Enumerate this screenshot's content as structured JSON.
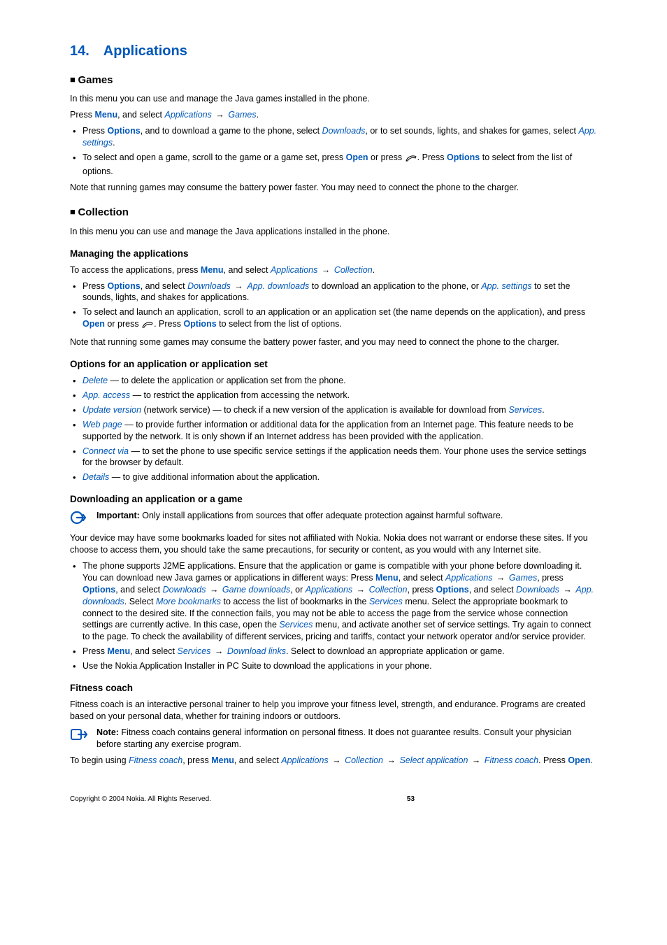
{
  "title": "14. Applications",
  "sections": {
    "games": {
      "heading": "Games",
      "p1": "In this menu you can use and manage the Java games installed in the phone.",
      "p2_pre": "Press ",
      "p2_menu": "Menu",
      "p2_mid": ", and select ",
      "p2_applications": "Applications",
      "p2_games": "Games",
      "p2_end": ".",
      "bullets": [
        {
          "pre": "Press ",
          "options": "Options",
          "mid1": ", and to download a game to the phone, select ",
          "downloads": "Downloads",
          "mid2": ", or to set sounds, lights, and shakes for games, select ",
          "appsettings": "App. settings",
          "end": "."
        },
        {
          "pre": "To select and open a game, scroll to the game or a game set, press ",
          "open": "Open",
          "mid1": " or press ",
          "mid2": ". Press ",
          "options": "Options",
          "end": " to select from the list of options."
        }
      ],
      "p3": "Note that running games may consume the battery power faster. You may need to connect the phone to the charger."
    },
    "collection": {
      "heading": "Collection",
      "p1": "In this menu you can use and manage the Java applications installed in the phone."
    },
    "managing": {
      "heading": "Managing the applications",
      "p1_pre": "To access the applications, press ",
      "p1_menu": "Menu",
      "p1_mid": ", and select ",
      "p1_applications": "Applications",
      "p1_collection": "Collection",
      "p1_end": ".",
      "bullets": [
        {
          "pre": "Press ",
          "options": "Options",
          "mid1": ", and select ",
          "downloads": "Downloads",
          "appdl": "App. downloads",
          "mid2": " to download an application to the phone, or ",
          "appsettings": "App. settings",
          "end": " to set the sounds, lights, and shakes for applications."
        },
        {
          "pre": "To select and launch an application, scroll to an application or an application set (the name depends on the application), and press ",
          "open": "Open",
          "mid1": " or press ",
          "mid2": ". Press ",
          "options": "Options",
          "end": " to select from the list of options."
        }
      ],
      "p2": "Note that running some games may consume the battery power faster, and you may need to connect the phone to the charger."
    },
    "options": {
      "heading": "Options for an application or application set",
      "items": [
        {
          "term": "Delete",
          "text": " — to delete the application or application set from the phone."
        },
        {
          "term": "App. access",
          "text": " —  to restrict the application from accessing the network."
        },
        {
          "term": "Update version",
          "text": " (network service) — to check if a new version of the application is available for download from ",
          "trail": "Services",
          "end": "."
        },
        {
          "term": "Web page",
          "text": " — to provide further information or additional data for the application from an Internet page. This feature needs to be supported by the network. It is only shown if an Internet address has been provided with the application."
        },
        {
          "term": "Connect via",
          "text": " —  to set the phone to use specific service settings if the application needs them. Your phone uses the service settings for the browser by default."
        },
        {
          "term": "Details",
          "text": " — to give additional information about the application."
        }
      ]
    },
    "downloading": {
      "heading": "Downloading an application or a game",
      "important_label": "Important:",
      "important_text": "  Only install applications from sources that offer adequate protection against harmful software.",
      "p1": "Your device may have some bookmarks loaded for sites not affiliated with Nokia. Nokia does not warrant or endorse these sites. If you choose to access them, you should take the same precautions, for security or content, as you would with any Internet site.",
      "b1": {
        "t1": "The phone supports J2ME applications. Ensure that the application or game is compatible with your phone before downloading it. You can download new Java games or applications in different ways: Press ",
        "menu1": "Menu",
        "t2": ", and select ",
        "apps": "Applications",
        "games": "Games",
        "t3": ", press ",
        "options1": "Options",
        "t4": ", and select ",
        "downloads": "Downloads",
        "gamedl": "Game downloads",
        "t5": ", or ",
        "apps2": "Applications",
        "coll": "Collection",
        "t6": ", press ",
        "options2": "Options",
        "t7": ", and select ",
        "downloads2": "Downloads",
        "appdl": "App. downloads",
        "t8": ". Select ",
        "morebm": "More bookmarks",
        "t9": " to access the list of bookmarks in the ",
        "services": "Services",
        "t10": " menu. Select the appropriate bookmark to connect to the desired site. If the connection fails, you may not be able to access the page from the service whose connection settings are currently active. In this case, open the ",
        "services2": "Services",
        "t11": " menu, and activate another set of service settings. Try again to connect to the page. To check the availability of different services, pricing and tariffs, contact your network operator and/or service provider."
      },
      "b2_pre": "Press ",
      "b2_menu": "Menu",
      "b2_mid1": ", and select ",
      "b2_services": "Services",
      "b2_dllinks": "Download links",
      "b2_end": ". Select to download an appropriate application or game.",
      "b3": "Use the Nokia Application Installer in PC Suite to download the applications in your phone."
    },
    "fitness": {
      "heading": "Fitness coach",
      "p1": "Fitness coach is an interactive personal trainer to help you improve your fitness level, strength, and endurance. Programs are created based on your personal data, whether for training indoors or outdoors.",
      "note_label": "Note:",
      "note_text": "  Fitness coach contains general information on personal fitness. It does not guarantee results. Consult your physician before starting any exercise program.",
      "p2_pre": "To begin using ",
      "p2_fc1": "Fitness coach",
      "p2_mid1": ", press ",
      "p2_menu": "Menu",
      "p2_mid2": ", and select ",
      "p2_apps": "Applications",
      "p2_coll": "Collection",
      "p2_selectapp": "Select application",
      "p2_fc2": "Fitness coach",
      "p2_mid3": ". Press ",
      "p2_open": "Open",
      "p2_end": "."
    }
  },
  "footer": {
    "copyright": "Copyright © 2004 Nokia. All Rights Reserved.",
    "page": "53"
  }
}
